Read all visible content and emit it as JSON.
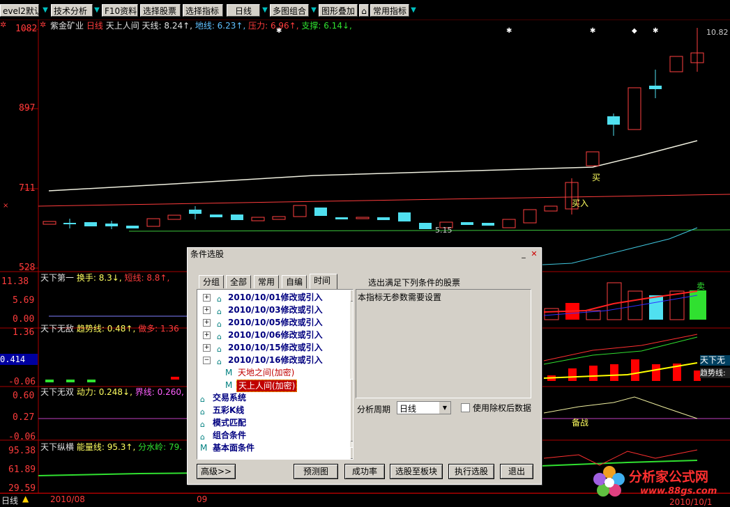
{
  "toolbar": {
    "items": [
      "evel2默认",
      "技术分析",
      "F10资料",
      "选择股票",
      "选择指标",
      "日线",
      "多图组合",
      "图形叠加",
      "常用指标"
    ]
  },
  "chart_header": {
    "stock": "紫金矿业",
    "period": "日线",
    "indicator": "天上人间",
    "tianxian": "天线: 8.24↑,",
    "dixian": "地线: 6.23↑,",
    "yali": "压力: 6.96↑,",
    "zhicheng": "支撑: 6.14↓,"
  },
  "main_axis": {
    "labels": [
      "1082",
      "897",
      "711",
      "528"
    ]
  },
  "main_marks": {
    "high": "10.82",
    "low": "5.15",
    "buy1": "买入",
    "buy2": "买"
  },
  "panel2": {
    "name": "天下第一",
    "turnover": "换手: 8.3↓,",
    "short": "短线: 8.8↑,",
    "axis": [
      "11.38",
      "5.69",
      "0.00"
    ],
    "sell": "卖"
  },
  "panel3": {
    "name": "天下无敌",
    "trend": "趋势线: 0.48↑,",
    "jiduo": "做多: 1.36",
    "axis": [
      "1.36",
      "0.414",
      "-0.06"
    ],
    "tag1": "天下无",
    "tag2": "趋势线:"
  },
  "panel4": {
    "name": "天下无双",
    "dongli": "动力: 0.248↓,",
    "jiexian": "界线: 0.260,",
    "axis": [
      "0.60",
      "0.27",
      "-0.06"
    ],
    "beizhan": "备战"
  },
  "panel5": {
    "name": "天下纵横",
    "energy": "能量线: 95.3↑,",
    "water": "分水岭: 79.",
    "axis": [
      "95.38",
      "61.89",
      "29.59"
    ]
  },
  "bottom": {
    "period": "日线",
    "date1": "2010/08",
    "date2": "09",
    "date3": "2010/10/1"
  },
  "watermark": {
    "name": "分析家公式网",
    "url": "www.88gs.com"
  },
  "dialog": {
    "title": "条件选股",
    "tabs": [
      "分组",
      "全部",
      "常用",
      "自编",
      "时间"
    ],
    "right_title": "选出满足下列条件的股票",
    "desc": "本指标无参数需要设置",
    "tree": [
      "2010/10/01修改或引入",
      "2010/10/03修改或引入",
      "2010/10/05修改或引入",
      "2010/10/06修改或引入",
      "2010/10/15修改或引入",
      "2010/10/16修改或引入",
      "天地之间(加密)",
      "天上人间(加密)",
      "交易系统",
      "五彩K线",
      "模式匹配",
      "组合条件",
      "基本面条件"
    ],
    "period_label": "分析周期",
    "period_value": "日线",
    "checkbox_label": "使用除权后数据",
    "buttons": [
      "高级>>",
      "预测图",
      "成功率",
      "选股至板块",
      "执行选股",
      "退出"
    ]
  }
}
